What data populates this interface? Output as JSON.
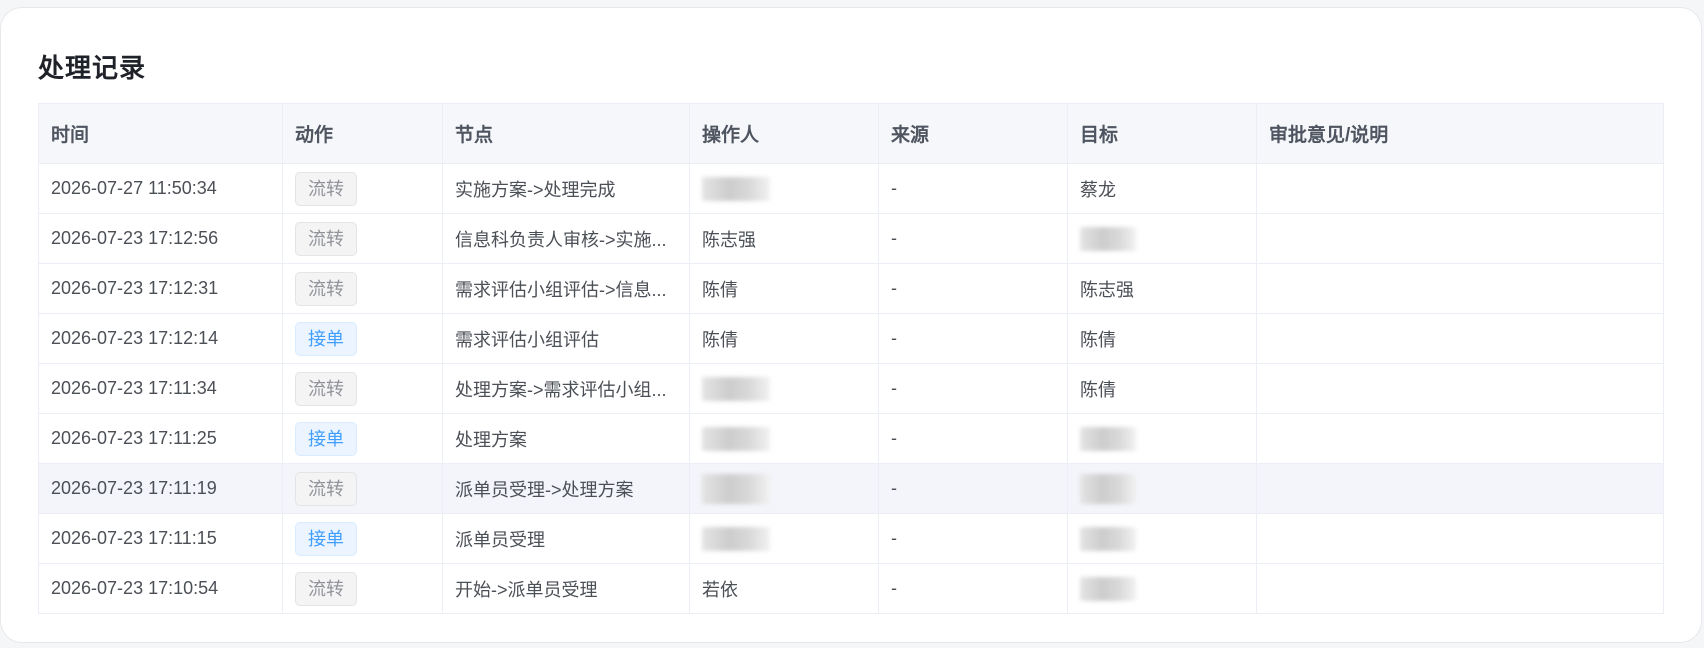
{
  "section": {
    "title": "处理记录"
  },
  "table": {
    "columns": [
      "时间",
      "动作",
      "节点",
      "操作人",
      "来源",
      "目标",
      "审批意见/说明"
    ],
    "rows": [
      {
        "time": "2026-07-27 11:50:34",
        "action": "流转",
        "action_type": "transfer",
        "node": "实施方案->处理完成",
        "operator": "",
        "operator_redacted": true,
        "source": "-",
        "target": "蔡龙",
        "target_redacted": false,
        "comment": ""
      },
      {
        "time": "2026-07-23 17:12:56",
        "action": "流转",
        "action_type": "transfer",
        "node": "信息科负责人审核->实施...",
        "operator": "陈志强",
        "operator_redacted": false,
        "source": "-",
        "target": "",
        "target_redacted": true,
        "comment": ""
      },
      {
        "time": "2026-07-23 17:12:31",
        "action": "流转",
        "action_type": "transfer",
        "node": "需求评估小组评估->信息...",
        "operator": "陈倩",
        "operator_redacted": false,
        "source": "-",
        "target": "陈志强",
        "target_redacted": false,
        "comment": ""
      },
      {
        "time": "2026-07-23 17:12:14",
        "action": "接单",
        "action_type": "accept",
        "node": "需求评估小组评估",
        "operator": "陈倩",
        "operator_redacted": false,
        "source": "-",
        "target": "陈倩",
        "target_redacted": false,
        "comment": ""
      },
      {
        "time": "2026-07-23 17:11:34",
        "action": "流转",
        "action_type": "transfer",
        "node": "处理方案->需求评估小组...",
        "operator": "",
        "operator_redacted": true,
        "source": "-",
        "target": "陈倩",
        "target_redacted": false,
        "comment": ""
      },
      {
        "time": "2026-07-23 17:11:25",
        "action": "接单",
        "action_type": "accept",
        "node": "处理方案",
        "operator": "",
        "operator_redacted": true,
        "source": "-",
        "target": "",
        "target_redacted": true,
        "comment": ""
      },
      {
        "time": "2026-07-23 17:11:19",
        "action": "流转",
        "action_type": "transfer",
        "node": "派单员受理->处理方案",
        "operator": "",
        "operator_redacted": true,
        "source": "-",
        "target": "",
        "target_redacted": true,
        "comment": "",
        "hovered": true
      },
      {
        "time": "2026-07-23 17:11:15",
        "action": "接单",
        "action_type": "accept",
        "node": "派单员受理",
        "operator": "",
        "operator_redacted": true,
        "source": "-",
        "target": "",
        "target_redacted": true,
        "comment": ""
      },
      {
        "time": "2026-07-23 17:10:54",
        "action": "流转",
        "action_type": "transfer",
        "node": "开始->派单员受理",
        "operator": "若依",
        "operator_redacted": false,
        "source": "-",
        "target": "",
        "target_redacted": true,
        "comment": ""
      }
    ]
  },
  "colors": {
    "tag_transfer_text": "#909399",
    "tag_accept_text": "#409eff",
    "header_bg": "#f5f7fa"
  }
}
